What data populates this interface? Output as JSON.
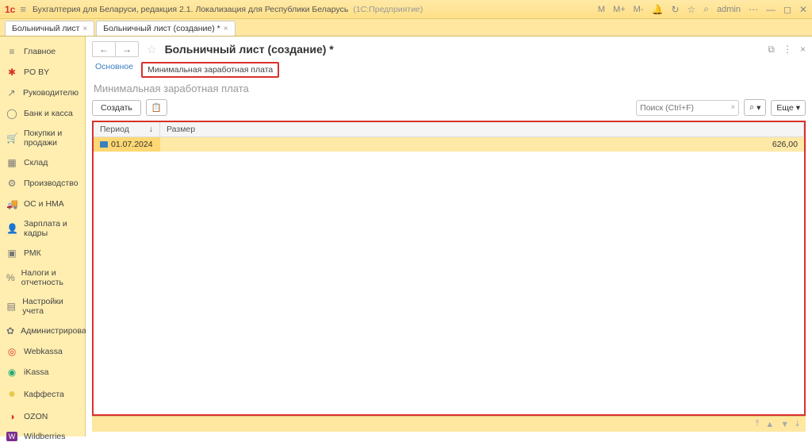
{
  "titlebar": {
    "logo": "1c",
    "app_title": "Бухгалтерия для Беларуси, редакция 2.1. Локализация для Республики Беларусь",
    "app_sub": "(1С:Предприятие)",
    "right": {
      "m": "M",
      "mplus": "M+",
      "mminus": "M-",
      "user": "admin"
    }
  },
  "doc_tabs": [
    {
      "label": "Больничный лист"
    },
    {
      "label": "Больничный лист (создание) *"
    }
  ],
  "sidebar": [
    {
      "icon": "≡",
      "label": "Главное"
    },
    {
      "icon": "✱",
      "label": "PO BY",
      "star": true
    },
    {
      "icon": "↗",
      "label": "Руководителю"
    },
    {
      "icon": "◯",
      "label": "Банк и касса"
    },
    {
      "icon": "🛒",
      "label": "Покупки и продажи"
    },
    {
      "icon": "▦",
      "label": "Склад"
    },
    {
      "icon": "⚙",
      "label": "Производство"
    },
    {
      "icon": "🚚",
      "label": "ОС и НМА"
    },
    {
      "icon": "👤",
      "label": "Зарплата и кадры"
    },
    {
      "icon": "▣",
      "label": "РМК"
    },
    {
      "icon": "%",
      "label": "Налоги и отчетность"
    },
    {
      "icon": "▤",
      "label": "Настройки учета"
    },
    {
      "icon": "✿",
      "label": "Администрирование"
    },
    {
      "icon": "◎",
      "label": "Webkassa"
    },
    {
      "icon": "◉",
      "label": "iKassa"
    },
    {
      "icon": "●",
      "label": "Каффеста"
    },
    {
      "icon": "◑",
      "label": "OZON"
    },
    {
      "icon": "W",
      "label": "Wildberries"
    }
  ],
  "main": {
    "title": "Больничный лист (создание) *",
    "subtabs": {
      "main": "Основное",
      "minwage": "Минимальная заработная плата"
    },
    "subtitle": "Минимальная заработная плата",
    "toolbar": {
      "create": "Создать",
      "more": "Еще"
    },
    "search": {
      "placeholder": "Поиск (Ctrl+F)"
    },
    "table": {
      "headers": {
        "period": "Период",
        "size": "Размер",
        "sort": "↓"
      },
      "rows": [
        {
          "date": "01.07.2024",
          "value": "626,00"
        }
      ]
    }
  }
}
